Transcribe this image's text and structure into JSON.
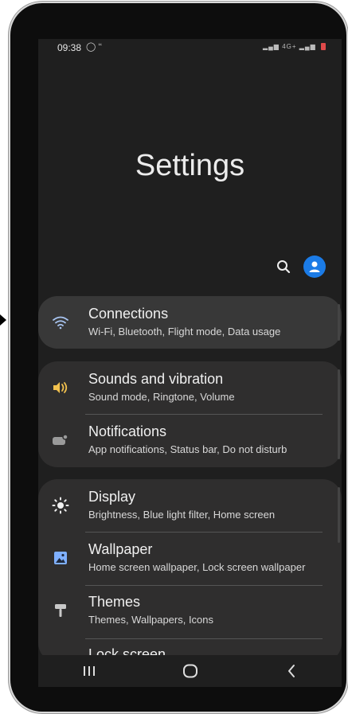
{
  "status_bar": {
    "time": "09:38",
    "network": "4G+"
  },
  "header": {
    "title": "Settings"
  },
  "sections": [
    {
      "items": [
        {
          "title": "Connections",
          "subtitle": "Wi-Fi, Bluetooth, Flight mode, Data usage"
        }
      ]
    },
    {
      "items": [
        {
          "title": "Sounds and vibration",
          "subtitle": "Sound mode, Ringtone, Volume"
        },
        {
          "title": "Notifications",
          "subtitle": "App notifications, Status bar, Do not disturb"
        }
      ]
    },
    {
      "items": [
        {
          "title": "Display",
          "subtitle": "Brightness, Blue light filter, Home screen"
        },
        {
          "title": "Wallpaper",
          "subtitle": "Home screen wallpaper, Lock screen wallpaper"
        },
        {
          "title": "Themes",
          "subtitle": "Themes, Wallpapers, Icons"
        },
        {
          "title": "Lock screen",
          "subtitle": ""
        }
      ]
    }
  ],
  "colors": {
    "accent": "#1b7be6",
    "background": "#1f1f1f",
    "card": "#2f2e2e",
    "wallpaper_icon": "#7fb0ff",
    "sound_icon": "#f2c14e"
  }
}
